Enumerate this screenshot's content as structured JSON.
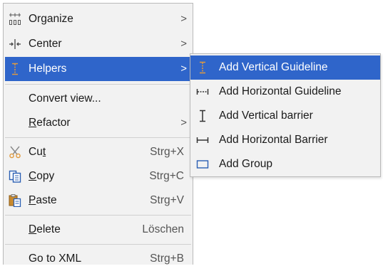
{
  "context_menu": {
    "items": [
      {
        "label": "Organize",
        "icon": "organize-icon",
        "has_submenu": true
      },
      {
        "label": "Center",
        "icon": "center-icon",
        "has_submenu": true
      },
      {
        "label": "Helpers",
        "icon": "vertical-guideline-icon",
        "has_submenu": true,
        "selected": true
      },
      {
        "label": "Convert view...",
        "icon": null,
        "has_submenu": false
      },
      {
        "label_before": "",
        "label_mnemonic": "R",
        "label_after": "efactor",
        "icon": null,
        "has_submenu": true
      },
      {
        "label_before": "Cu",
        "label_mnemonic": "t",
        "label_after": "",
        "icon": "scissors-icon",
        "shortcut": "Strg+X"
      },
      {
        "label_before": "",
        "label_mnemonic": "C",
        "label_after": "opy",
        "icon": "copy-icon",
        "shortcut": "Strg+C"
      },
      {
        "label_before": "",
        "label_mnemonic": "P",
        "label_after": "aste",
        "icon": "paste-icon",
        "shortcut": "Strg+V"
      },
      {
        "label_before": "",
        "label_mnemonic": "D",
        "label_after": "elete",
        "icon": null,
        "shortcut": "Löschen"
      },
      {
        "label": "Go to XML",
        "icon": null,
        "shortcut": "Strg+B"
      }
    ],
    "submenu_arrow": ">"
  },
  "helpers_submenu": {
    "items": [
      {
        "label": "Add Vertical Guideline",
        "icon": "vertical-guideline-icon",
        "selected": true
      },
      {
        "label": "Add Horizontal Guideline",
        "icon": "horizontal-guideline-icon"
      },
      {
        "label": "Add Vertical barrier",
        "icon": "vertical-barrier-icon"
      },
      {
        "label": "Add Horizontal Barrier",
        "icon": "horizontal-barrier-icon"
      },
      {
        "label": "Add Group",
        "icon": "group-icon"
      }
    ]
  },
  "colors": {
    "menu_background": "#f2f2f2",
    "selection_background": "#2f65ca",
    "selection_text": "#ffffff",
    "separator": "#d0d0d0",
    "icon_blue": "#2b5fb3",
    "icon_orange": "#e09a3e"
  }
}
